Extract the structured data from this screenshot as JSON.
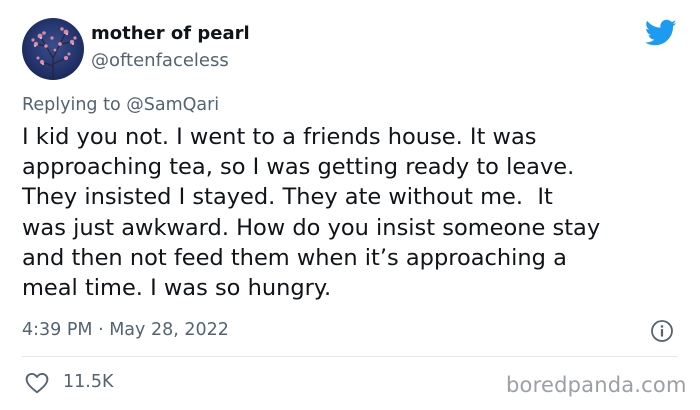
{
  "author": {
    "display_name": "mother of pearl",
    "handle": "@oftenfaceless",
    "avatar": "avatar-photo"
  },
  "reply": {
    "prefix": "Replying to ",
    "mention": "@SamQari"
  },
  "tweet": {
    "text": "I kid you not. I went to a friends house. It was\napproaching tea, so I was getting ready to leave.\nThey insisted I stayed. They ate without me.  It\nwas just awkward. How do you insist someone stay\nand then not feed them when it’s approaching a\nmeal time. I was so hungry.",
    "timestamp": "4:39 PM · May 28, 2022"
  },
  "actions": {
    "likes": "11.5K"
  },
  "icons": {
    "platform": "twitter-bird-icon",
    "info": "info-icon",
    "like": "heart-icon"
  },
  "colors": {
    "brand": "#1d9bf0",
    "secondary_text": "#536471",
    "primary_text": "#0f1419"
  },
  "watermark": "boredpanda.com"
}
